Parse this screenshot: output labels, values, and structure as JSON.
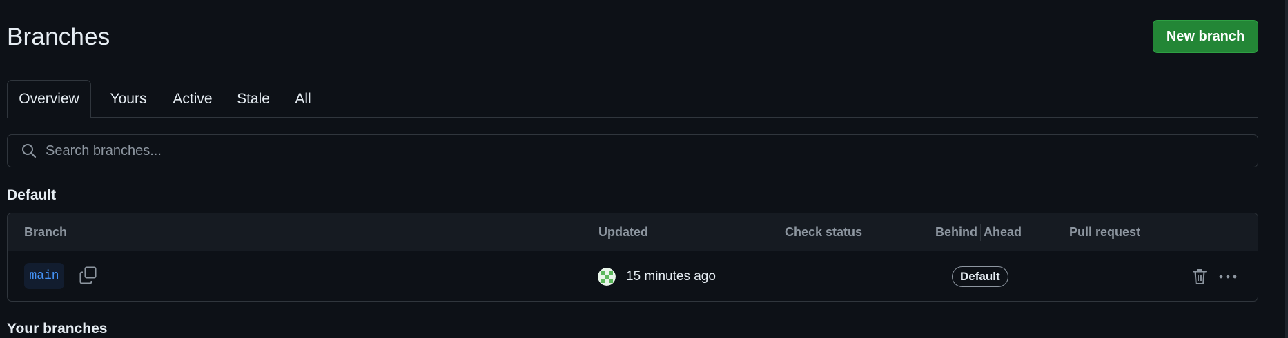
{
  "header": {
    "title": "Branches",
    "new_branch_label": "New branch"
  },
  "tabs": [
    {
      "label": "Overview",
      "selected": true
    },
    {
      "label": "Yours",
      "selected": false
    },
    {
      "label": "Active",
      "selected": false
    },
    {
      "label": "Stale",
      "selected": false
    },
    {
      "label": "All",
      "selected": false
    }
  ],
  "search": {
    "placeholder": "Search branches...",
    "value": "",
    "icon": "search-icon"
  },
  "sections": {
    "default_heading": "Default",
    "yours_heading": "Your branches"
  },
  "table": {
    "columns": {
      "branch": "Branch",
      "updated": "Updated",
      "check_status": "Check status",
      "behind": "Behind",
      "ahead": "Ahead",
      "pull_request": "Pull request"
    },
    "rows": [
      {
        "branch": "main",
        "updated": "15 minutes ago",
        "badge": "Default",
        "icons": [
          "copy-icon",
          "avatar",
          "trash-icon",
          "kebab-horizontal-icon"
        ]
      }
    ]
  },
  "colors": {
    "background": "#0d1117",
    "primary_button": "#238636",
    "border": "#30363d",
    "branch_link": "#4493f8",
    "muted_text": "#8d96a0"
  }
}
